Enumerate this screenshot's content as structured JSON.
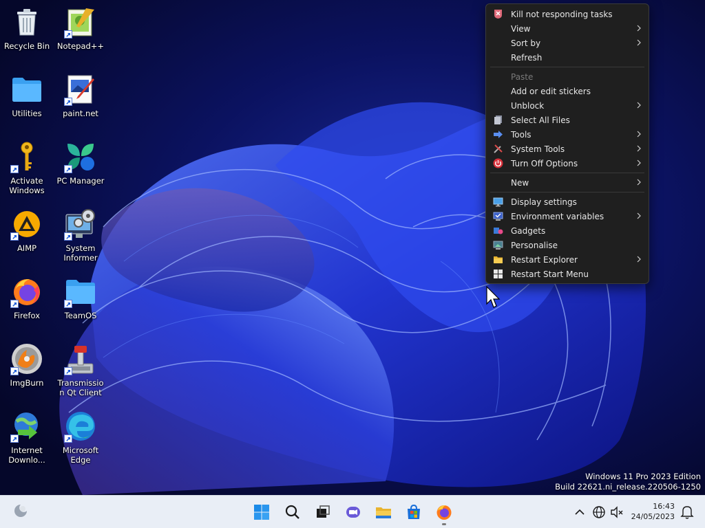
{
  "desktop": {
    "icons": [
      {
        "label": "Recycle Bin"
      },
      {
        "label": "Notepad++"
      },
      {
        "label": "Utilities"
      },
      {
        "label": "paint.net"
      },
      {
        "label": "Activate Windows"
      },
      {
        "label": "PC Manager"
      },
      {
        "label": "AIMP"
      },
      {
        "label": "System Informer"
      },
      {
        "label": "Firefox"
      },
      {
        "label": "TeamOS"
      },
      {
        "label": "ImgBurn"
      },
      {
        "label": "Transmission Qt Client"
      },
      {
        "label": "Internet Downlo..."
      },
      {
        "label": "Microsoft Edge"
      }
    ]
  },
  "context_menu": {
    "items": [
      {
        "label": "Kill not responding tasks",
        "icon": "kill-tasks-icon"
      },
      {
        "label": "View",
        "submenu": true
      },
      {
        "label": "Sort by",
        "submenu": true
      },
      {
        "label": "Refresh"
      },
      {
        "label": "Paste",
        "disabled": true
      },
      {
        "label": "Add or edit stickers"
      },
      {
        "label": "Unblock",
        "submenu": true
      },
      {
        "label": "Select All Files",
        "icon": "select-all-icon"
      },
      {
        "label": "Tools",
        "submenu": true,
        "icon": "tools-arrow-icon"
      },
      {
        "label": "System Tools",
        "submenu": true,
        "icon": "system-tools-icon"
      },
      {
        "label": "Turn Off Options",
        "submenu": true,
        "icon": "power-icon"
      },
      {
        "label": "New",
        "submenu": true
      },
      {
        "label": "Display settings",
        "icon": "display-icon"
      },
      {
        "label": "Environment variables",
        "submenu": true,
        "icon": "env-vars-icon"
      },
      {
        "label": "Gadgets",
        "icon": "gadgets-icon"
      },
      {
        "label": "Personalise",
        "icon": "personalise-icon"
      },
      {
        "label": "Restart Explorer",
        "submenu": true,
        "icon": "folder-icon"
      },
      {
        "label": "Restart Start Menu",
        "icon": "windows-logo-icon"
      }
    ]
  },
  "watermark": {
    "line1": "Windows 11 Pro 2023 Edition",
    "line2": "Build 22621.ni_release.220506-1250"
  },
  "taskbar": {
    "time": "16:43",
    "date": "24/05/2023",
    "apps": [
      "widgets",
      "start",
      "search",
      "task-view",
      "chat",
      "file-explorer",
      "store",
      "firefox"
    ]
  },
  "colors": {
    "menu_bg": "#1f1f1f",
    "menu_text": "#e8e8e8",
    "taskbar_bg": "#e9eef6",
    "accent": "#0078d4"
  }
}
